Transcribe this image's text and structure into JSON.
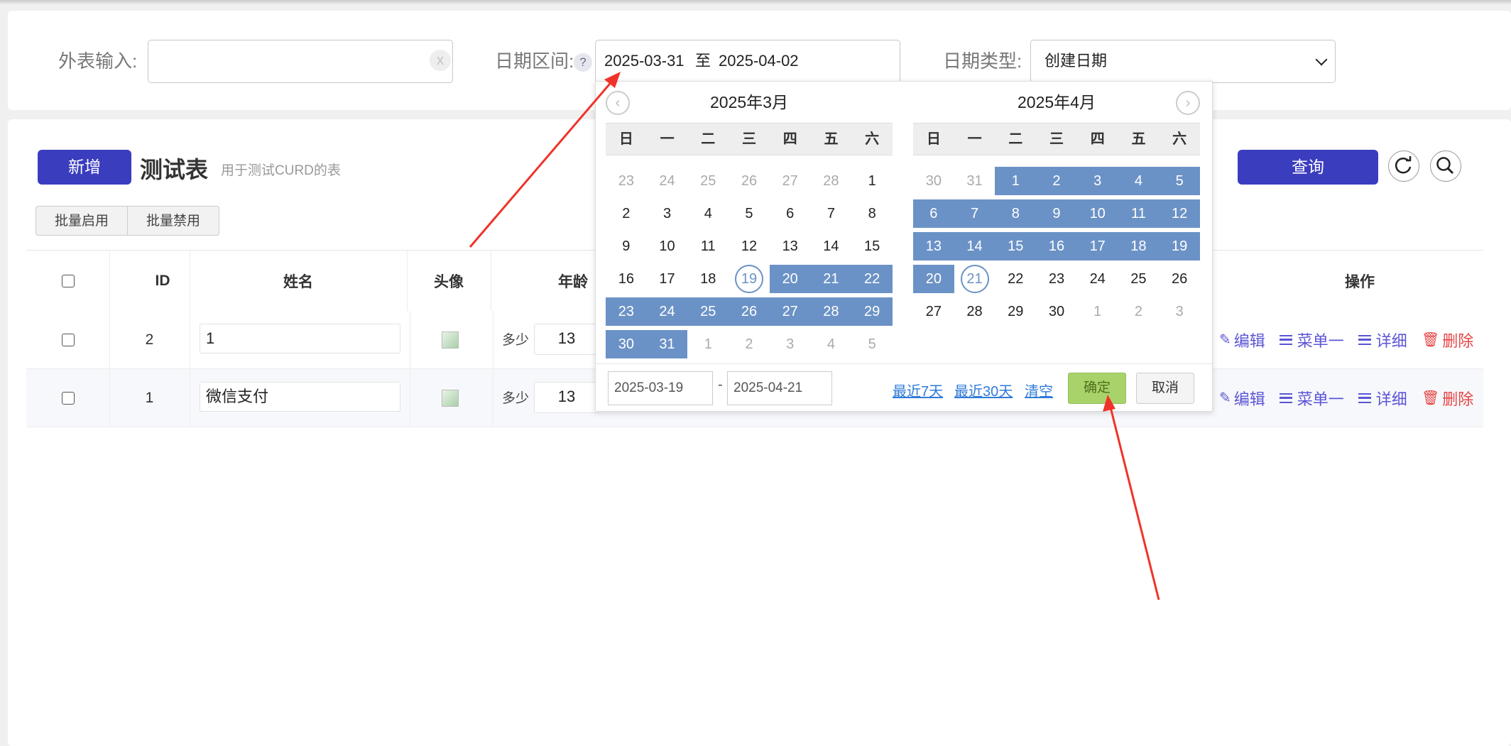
{
  "filters": {
    "outer_label": "外表输入:",
    "outer_value": "",
    "clear_symbol": "x",
    "date_range_label": "日期区间:",
    "help_symbol": "?",
    "date_start": "2025-03-31",
    "date_sep": "至",
    "date_end": "2025-04-02",
    "date_type_label": "日期类型:",
    "date_type_selected": "创建日期"
  },
  "toolbar": {
    "add_label": "新增",
    "title": "测试表",
    "subtitle": "用于测试CURD的表",
    "batch_enable": "批量启用",
    "batch_disable": "批量禁用",
    "query_label": "查询",
    "refresh_icon": "refresh-icon",
    "search_icon": "search-icon"
  },
  "table": {
    "headers": {
      "id": "ID",
      "name": "姓名",
      "avatar": "头像",
      "age": "年龄",
      "actions": "操作"
    },
    "rows": [
      {
        "id": "2",
        "name": "1",
        "age_label": "多少",
        "age": "13"
      },
      {
        "id": "1",
        "name": "微信支付",
        "age_label": "多少",
        "age": "13"
      }
    ],
    "actions": {
      "edit": "编辑",
      "menu1": "菜单一",
      "detail": "详细",
      "delete": "删除"
    }
  },
  "datepicker": {
    "left_title": "2025年3月",
    "right_title": "2025年4月",
    "weekdays": [
      "日",
      "一",
      "二",
      "三",
      "四",
      "五",
      "六"
    ],
    "left_days": [
      "23",
      "24",
      "25",
      "26",
      "27",
      "28",
      "1",
      "2",
      "3",
      "4",
      "5",
      "6",
      "7",
      "8",
      "9",
      "10",
      "11",
      "12",
      "13",
      "14",
      "15",
      "16",
      "17",
      "18",
      "19",
      "20",
      "21",
      "22",
      "23",
      "24",
      "25",
      "26",
      "27",
      "28",
      "29",
      "30",
      "31",
      "1",
      "2",
      "3",
      "4",
      "5"
    ],
    "right_days": [
      "30",
      "31",
      "1",
      "2",
      "3",
      "4",
      "5",
      "6",
      "7",
      "8",
      "9",
      "10",
      "11",
      "12",
      "13",
      "14",
      "15",
      "16",
      "17",
      "18",
      "19",
      "20",
      "21",
      "22",
      "23",
      "24",
      "25",
      "26",
      "27",
      "28",
      "29",
      "30",
      "1",
      "2",
      "3"
    ],
    "range_start_input": "2025-03-19",
    "range_dash": "-",
    "range_end_input": "2025-04-21",
    "last7": "最近7天",
    "last30": "最近30天",
    "clear": "清空",
    "ok": "确定",
    "cancel": "取消",
    "accent": "#6b92c6"
  }
}
